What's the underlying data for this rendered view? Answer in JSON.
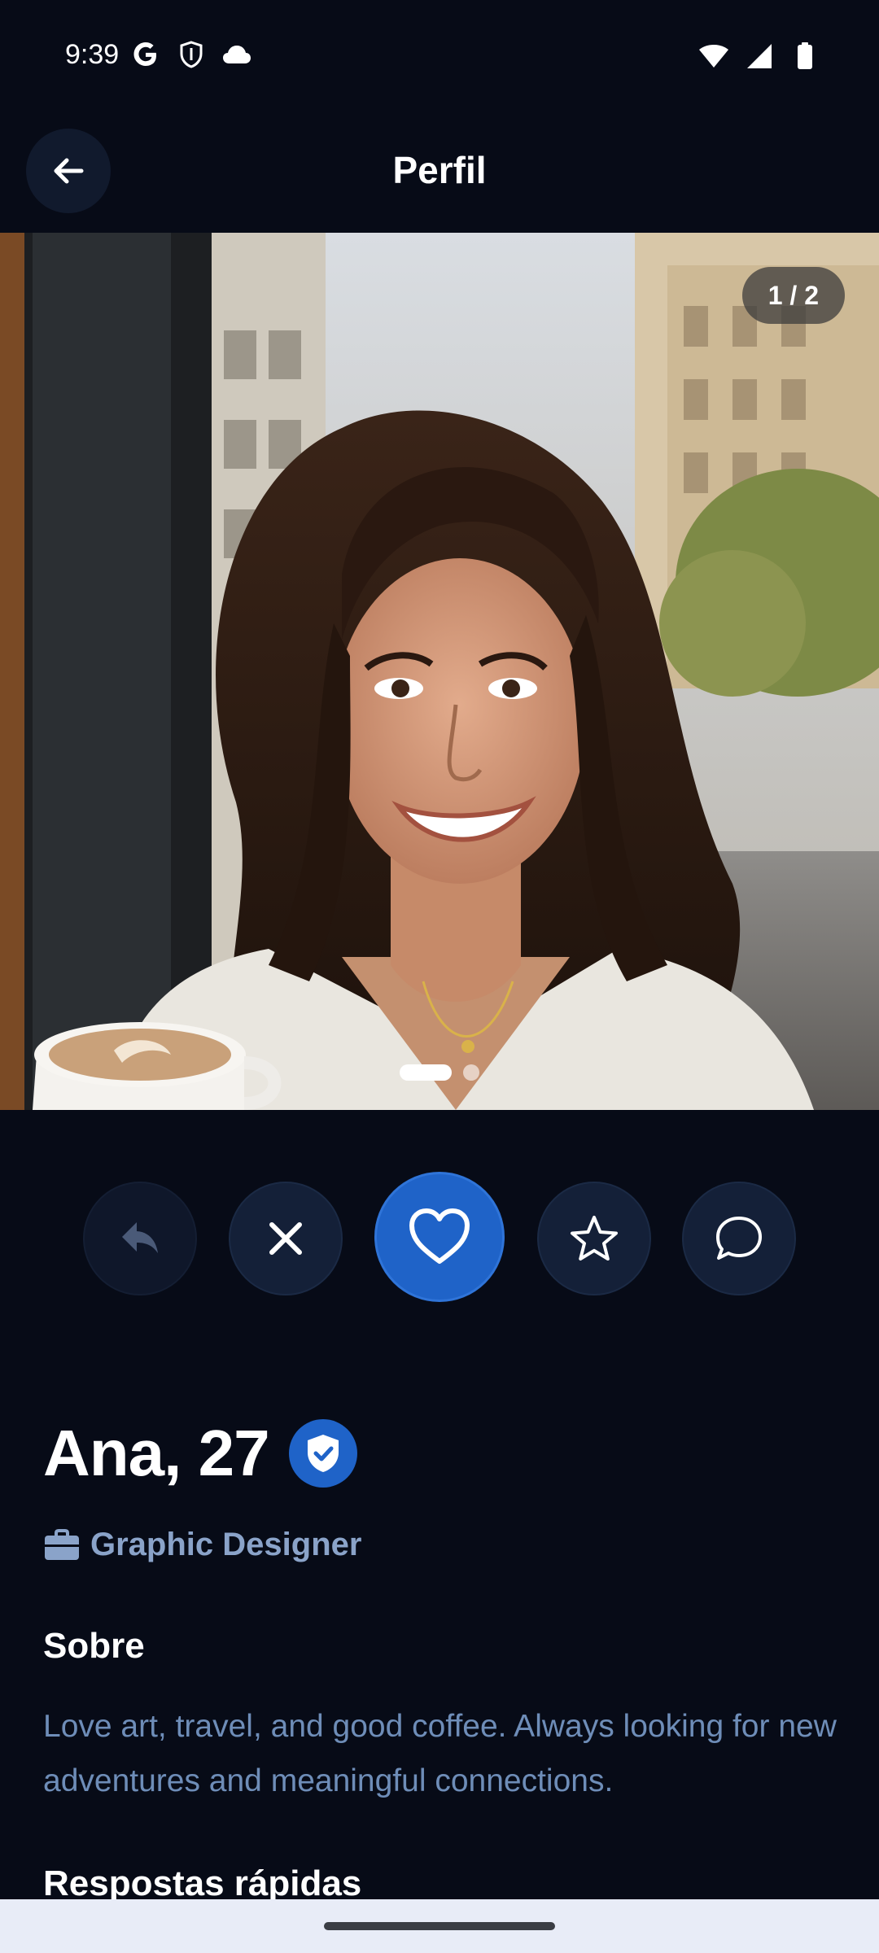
{
  "status_bar": {
    "time": "9:39",
    "left_icons": [
      "google-icon",
      "shield-icon",
      "cloud-icon"
    ],
    "right_icons": [
      "wifi-icon",
      "signal-icon",
      "battery-icon"
    ]
  },
  "app_bar": {
    "title": "Perfil",
    "back_icon": "arrow-left-icon"
  },
  "photo": {
    "counter": "1 / 2",
    "current_index": 1,
    "total": 2
  },
  "actions": {
    "items": [
      {
        "name": "rewind",
        "icon": "undo-icon"
      },
      {
        "name": "pass",
        "icon": "close-icon"
      },
      {
        "name": "like",
        "icon": "heart-icon"
      },
      {
        "name": "superlike",
        "icon": "star-icon"
      },
      {
        "name": "message",
        "icon": "chat-bubble-icon"
      }
    ]
  },
  "profile": {
    "name_age": "Ana, 27",
    "verified": true,
    "job": "Graphic Designer",
    "about_title": "Sobre",
    "about_text": "Love art, travel, and good coffee. Always looking for new adventures and meaningful connections.",
    "quick_answers_title": "Respostas rápidas"
  },
  "colors": {
    "background": "#070b17",
    "accent": "#1f63c8",
    "button_bg": "#142038",
    "muted_text": "#6e8db8",
    "job_text": "#8aa3c9"
  }
}
